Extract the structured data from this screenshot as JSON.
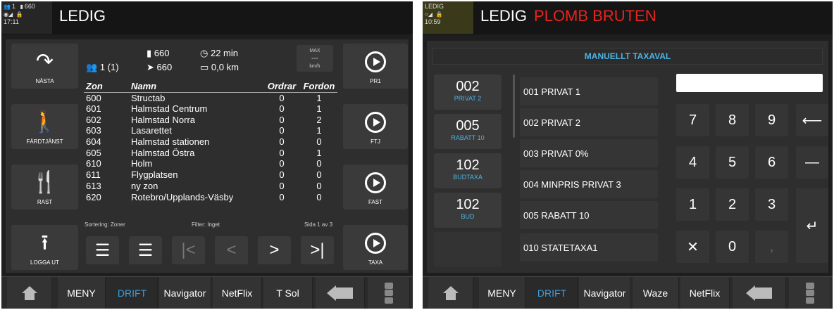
{
  "left": {
    "status": {
      "users": "1",
      "map_count": "660",
      "time": "17:11"
    },
    "title": "LEDIG",
    "buttons": {
      "nasta": "NÄSTA",
      "fardtjanst": "FÄRDTJÄNST",
      "rast": "RAST",
      "logga_ut": "LOGGA UT",
      "pr1": "PR1",
      "ftj": "FTJ",
      "fast": "FAST",
      "taxa": "TAXA"
    },
    "info": {
      "users": "1 (1)",
      "map": "660",
      "direction": "660",
      "time": "22 min",
      "distance": "0,0 km"
    },
    "speed": {
      "label": "MAX",
      "value": "---",
      "unit": "km/h"
    },
    "table": {
      "headers": [
        "Zon",
        "Namn",
        "Ordrar",
        "Fordon"
      ],
      "rows": [
        [
          "600",
          "Structab",
          "0",
          "1"
        ],
        [
          "601",
          "Halmstad Centrum",
          "0",
          "1"
        ],
        [
          "602",
          "Halmstad Norra",
          "0",
          "2"
        ],
        [
          "603",
          "Lasarettet",
          "0",
          "1"
        ],
        [
          "604",
          "Halmstad stationen",
          "0",
          "0"
        ],
        [
          "605",
          "Halmstad Östra",
          "0",
          "1"
        ],
        [
          "610",
          "Holm",
          "0",
          "0"
        ],
        [
          "611",
          "Flygplatsen",
          "0",
          "0"
        ],
        [
          "613",
          "ny zon",
          "0",
          "0"
        ],
        [
          "620",
          "Rotebro/Upplands-Väsby",
          "0",
          "0"
        ]
      ]
    },
    "footer": {
      "sort": "Sortering: Zoner",
      "filter": "Filter: Inget",
      "page": "Sida 1 av 3"
    },
    "tabs": [
      "MENY",
      "DRIFT",
      "Navigator",
      "NetFlix",
      "T Sol"
    ]
  },
  "right": {
    "status": {
      "label": "LEDIG",
      "time": "10:59"
    },
    "title": "LEDIG",
    "title_alert": "PLOMB BRUTEN",
    "header": "MANUELLT TAXAVAL",
    "codes": [
      {
        "code": "002",
        "sub": "PRIVAT 2"
      },
      {
        "code": "005",
        "sub": "RABATT 10"
      },
      {
        "code": "102",
        "sub": "BUDTAXA"
      },
      {
        "code": "102",
        "sub": "BUD"
      }
    ],
    "list": [
      "001  PRIVAT 1",
      "002  PRIVAT 2",
      "003  PRIVAT 0%",
      "004  MINPRIS PRIVAT 3",
      "005  RABATT 10",
      "010  STATETAXA1"
    ],
    "input_value": "",
    "keys": [
      "7",
      "8",
      "9",
      "4",
      "5",
      "6",
      "1",
      "2",
      "3",
      "0",
      ","
    ],
    "tabs": [
      "MENY",
      "DRIFT",
      "Navigator",
      "Waze",
      "NetFlix"
    ]
  },
  "colors": {
    "accent": "#3a9fe0",
    "alert": "#e8231f",
    "background": "#1e1e1e"
  }
}
